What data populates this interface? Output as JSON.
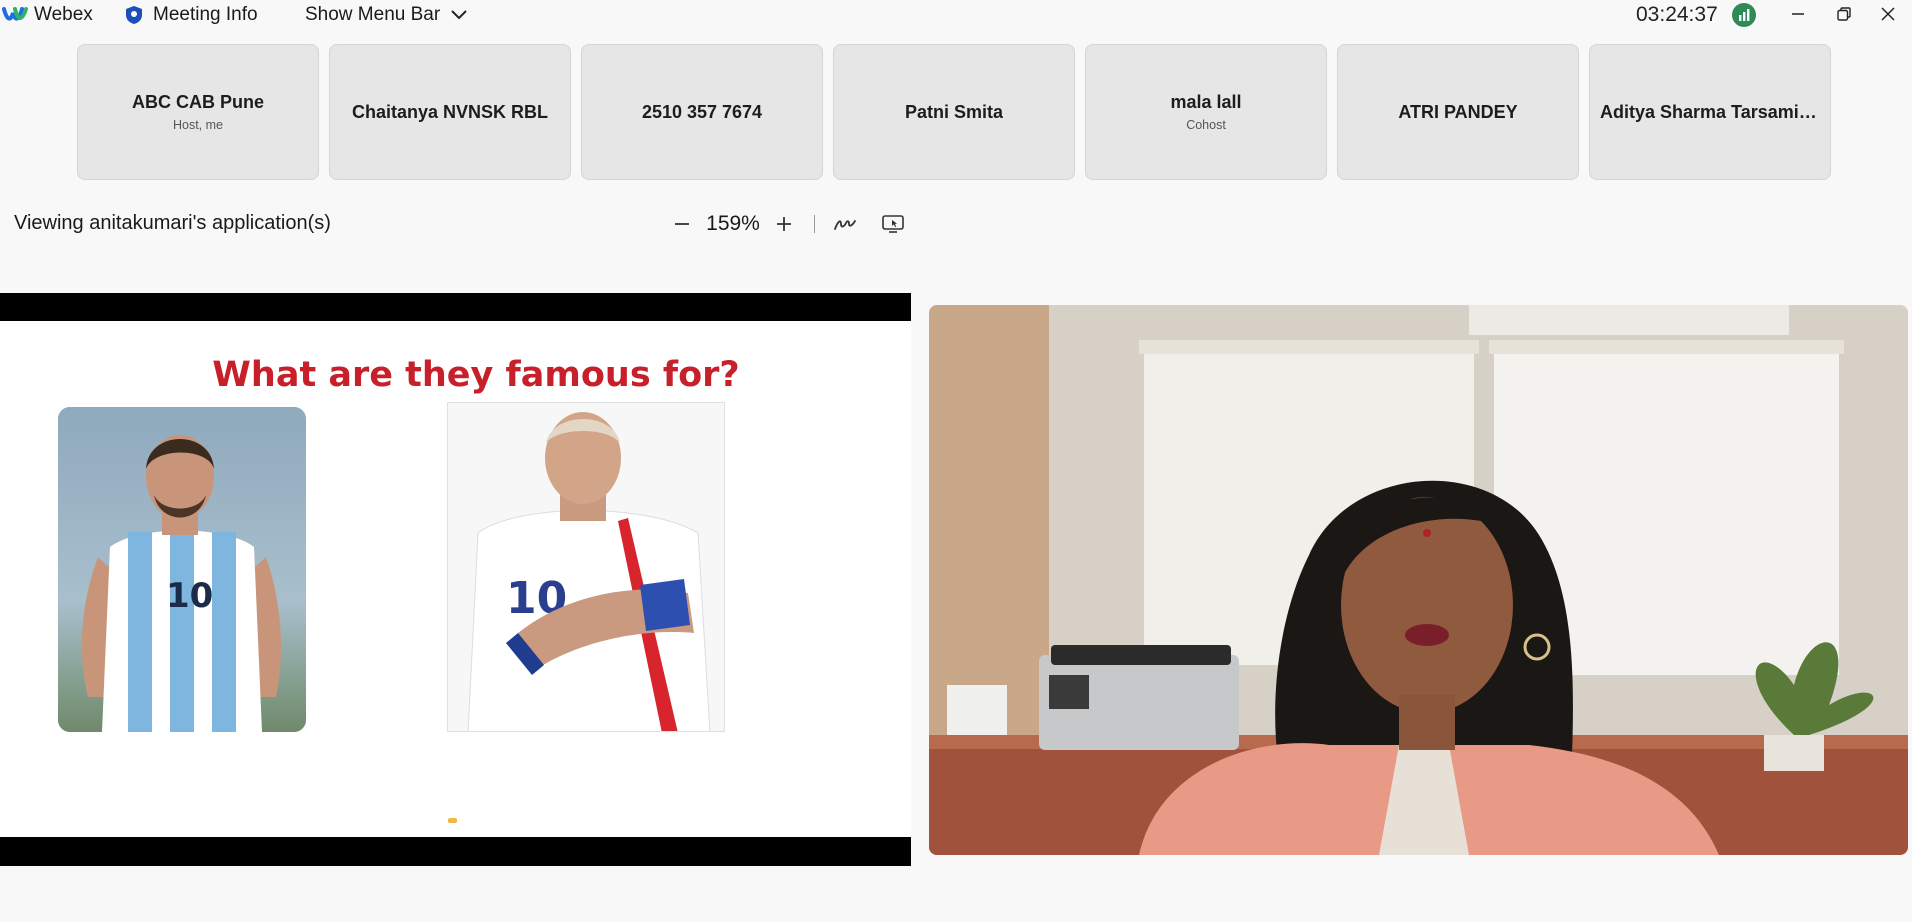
{
  "titlebar": {
    "app_name": "Webex",
    "meeting_info": "Meeting Info",
    "show_menu_bar": "Show Menu Bar",
    "clock": "03:24:37"
  },
  "participants": [
    {
      "name": "ABC CAB Pune",
      "role": "Host, me"
    },
    {
      "name": "Chaitanya NVNSK RBL",
      "role": ""
    },
    {
      "name": "2510 357 7674",
      "role": ""
    },
    {
      "name": "Patni Smita",
      "role": ""
    },
    {
      "name": "mala lall",
      "role": "Cohost"
    },
    {
      "name": "ATRI PANDEY",
      "role": ""
    },
    {
      "name": "Aditya Sharma Tarsamiy...",
      "role": ""
    }
  ],
  "sharing": {
    "label": "Viewing anitakumari's application(s)",
    "zoom": "159%"
  },
  "slide": {
    "title": "What are they famous for?"
  },
  "colors": {
    "accent_red": "#c8202a",
    "signal_green": "#2e8b57"
  }
}
